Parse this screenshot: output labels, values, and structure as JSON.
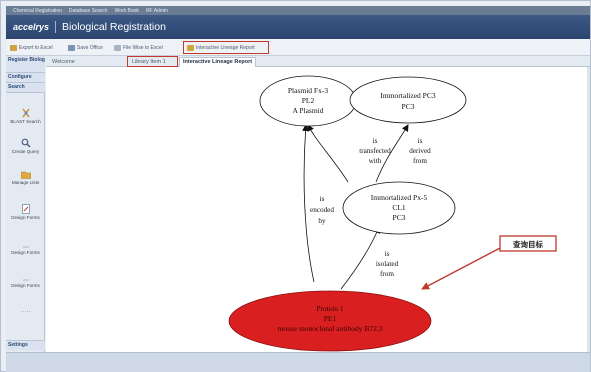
{
  "topnav": {
    "items": [
      "Chemical Registration",
      "Database Search",
      "Work Book",
      "RF Admin"
    ]
  },
  "brand": {
    "logo": "accelrys",
    "title": "Biological Registration"
  },
  "toolbar": {
    "buttons": [
      "Export to Excel",
      "Save Office",
      "File Wise to Excel",
      "Interactive Lineage Report"
    ]
  },
  "sidebar": {
    "sections": [
      "Register Biologics",
      "Configure",
      "Search"
    ],
    "items": [
      "BLAST Search",
      "Create Query",
      "Manage Lists",
      "Design Forms",
      "Design Forms",
      "Design Forms"
    ],
    "settings": "Settings"
  },
  "tabs": [
    "Welcome",
    "Library Item 1",
    "Interactive Lineage Report"
  ],
  "graph": {
    "nodes": [
      {
        "lines": [
          "Plasmid Fx-3",
          "PL2",
          "A Plasmid"
        ]
      },
      {
        "lines": [
          "Immortalized PC3",
          "PC3"
        ]
      },
      {
        "lines": [
          "Immortalized Px-5",
          "CL1",
          "PC3"
        ]
      },
      {
        "lines": [
          "Protein 1",
          "PE1",
          "mouse monoclonal antibody B72.3"
        ]
      }
    ],
    "edges": [
      {
        "lines": [
          "is",
          "transfected",
          "with"
        ]
      },
      {
        "lines": [
          "is",
          "derived",
          "from"
        ]
      },
      {
        "lines": [
          "is",
          "encoded",
          "by"
        ]
      },
      {
        "lines": [
          "is",
          "isolated",
          "from"
        ]
      }
    ],
    "callout": "查询目标"
  },
  "colors": {
    "highlight": "#c0392b",
    "target_node": "#d91f1f"
  }
}
